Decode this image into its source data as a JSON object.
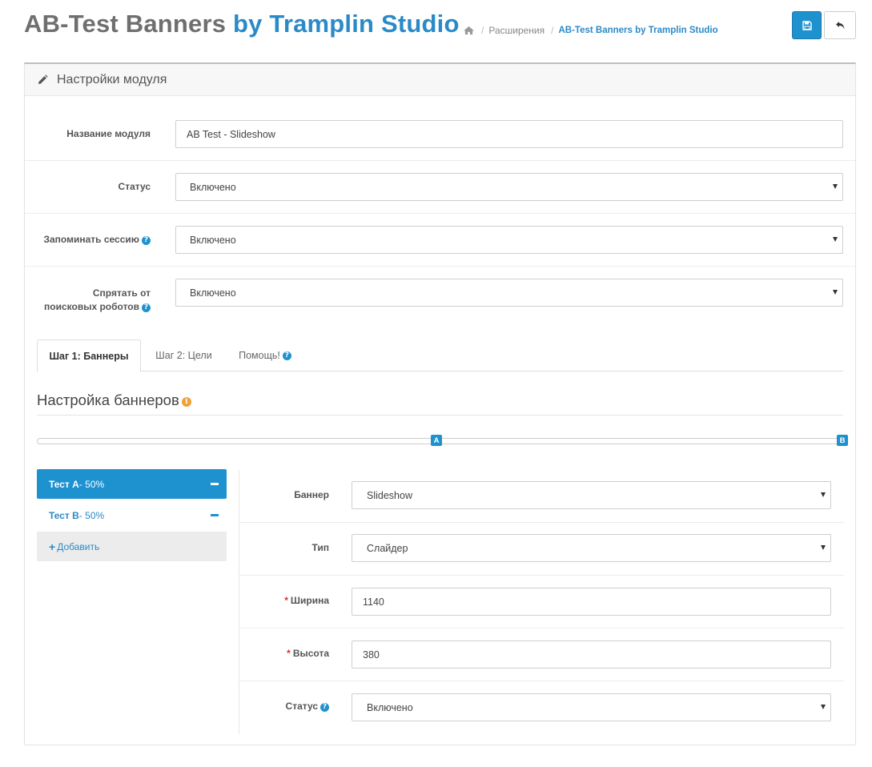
{
  "header": {
    "title_main": "AB-Test Banners ",
    "title_accent": "by Tramplin Studio",
    "breadcrumb": [
      "Расширения",
      "AB-Test Banners by Tramplin Studio"
    ]
  },
  "panel": {
    "heading": "Настройки модуля",
    "fields": {
      "name_label": "Название модуля",
      "name_value": "AB Test - Slideshow",
      "status_label": "Статус",
      "status_value": "Включено",
      "session_label": "Запоминать сессию",
      "session_value": "Включено",
      "hide_label_line1": "Спрятать от",
      "hide_label_line2": "поисковых роботов",
      "hide_value": "Включено"
    },
    "tabs": [
      "Шаг 1: Баннеры",
      "Шаг 2: Цели",
      "Помощь!"
    ],
    "section_title": "Настройка баннеров",
    "split": {
      "handle_a": "A",
      "handle_b": "B",
      "split_fraction_a": 0.5
    },
    "variants": [
      {
        "name": "Тест A",
        "share": " - 50%"
      },
      {
        "name": "Тест B",
        "share": " - 50%"
      }
    ],
    "add_label": "Добавить",
    "variant_form": {
      "banner_label": "Баннер",
      "banner_value": "Slideshow",
      "type_label": "Тип",
      "type_value": "Слайдер",
      "width_label": "Ширина",
      "width_value": "1140",
      "height_label": "Высота",
      "height_value": "380",
      "status_label": "Статус",
      "status_value": "Включено"
    }
  },
  "colors": {
    "accent": "#1e91cf",
    "required": "#d9302c",
    "info": "#f0a035"
  },
  "icons": [
    "home-icon",
    "save-icon",
    "back-icon",
    "pencil-icon",
    "question-icon",
    "info-icon",
    "minus-icon",
    "plus-icon",
    "caret-down-icon"
  ]
}
